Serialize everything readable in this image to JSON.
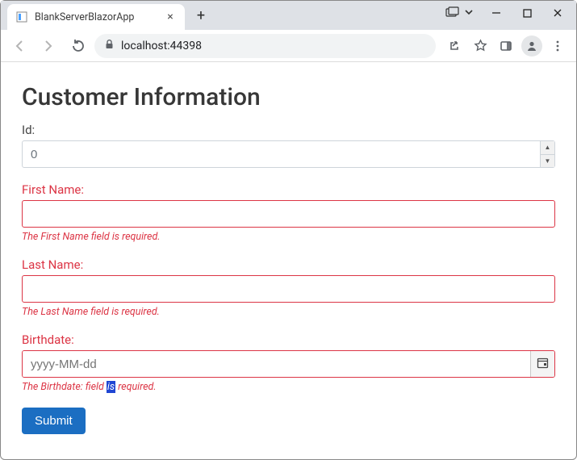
{
  "browser": {
    "tab_title": "BlankServerBlazorApp",
    "url": "localhost:44398"
  },
  "page": {
    "heading": "Customer Information",
    "submit_label": "Submit"
  },
  "form": {
    "id": {
      "label": "Id:",
      "value": "0",
      "invalid": false
    },
    "first_name": {
      "label": "First Name:",
      "value": "",
      "invalid": true,
      "error": "The First Name field is required."
    },
    "last_name": {
      "label": "Last Name:",
      "value": "",
      "invalid": true,
      "error": "The Last Name field is required."
    },
    "birthdate": {
      "label": "Birthdate:",
      "placeholder": "yyyy-MM-dd",
      "value": "",
      "invalid": true,
      "error_pre": "The Birthdate: field ",
      "error_sel": "is",
      "error_post": " required."
    }
  },
  "colors": {
    "error": "#dc3545",
    "primary": "#1b6ec2"
  }
}
